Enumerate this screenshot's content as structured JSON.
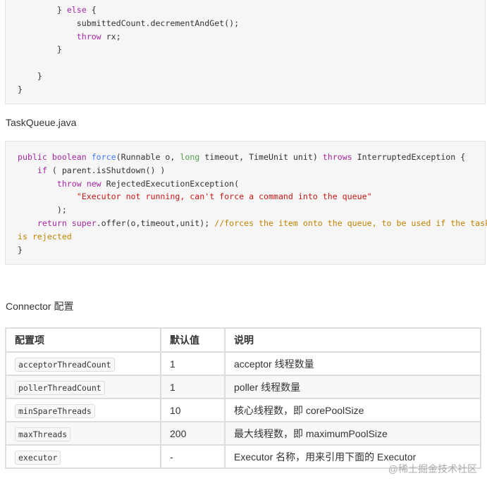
{
  "code1": {
    "lines": [
      [
        {
          "t": "        } "
        },
        {
          "t": "else",
          "c": "kw"
        },
        {
          "t": " {"
        }
      ],
      [
        {
          "t": "            submittedCount.decrementAndGet();"
        }
      ],
      [
        {
          "t": "            "
        },
        {
          "t": "throw",
          "c": "kw"
        },
        {
          "t": " rx;"
        }
      ],
      [
        {
          "t": "        }"
        }
      ],
      [
        {
          "t": ""
        }
      ],
      [
        {
          "t": "    }"
        }
      ],
      [
        {
          "t": "}"
        }
      ]
    ]
  },
  "label1": "TaskQueue.java",
  "code2": {
    "lines": [
      [
        {
          "t": "public boolean ",
          "c": "kw"
        },
        {
          "t": "force",
          "c": "fn"
        },
        {
          "t": "(Runnable o, "
        },
        {
          "t": "long",
          "c": "ty"
        },
        {
          "t": " timeout, TimeUnit unit) "
        },
        {
          "t": "throws",
          "c": "kw"
        },
        {
          "t": " InterruptedException {"
        }
      ],
      [
        {
          "t": "    "
        },
        {
          "t": "if",
          "c": "kw"
        },
        {
          "t": " ( parent.isShutdown() )"
        }
      ],
      [
        {
          "t": "        "
        },
        {
          "t": "throw new",
          "c": "kw"
        },
        {
          "t": " RejectedExecutionException("
        }
      ],
      [
        {
          "t": "            "
        },
        {
          "t": "\"Executor not running, can't force a command into the queue\"",
          "c": "str"
        }
      ],
      [
        {
          "t": "        );"
        }
      ],
      [
        {
          "t": "    "
        },
        {
          "t": "return super",
          "c": "kw"
        },
        {
          "t": ".offer(o,timeout,unit); "
        },
        {
          "t": "//forces the item onto the queue, to be used if the task",
          "c": "cm"
        }
      ],
      [
        {
          "t": "is rejected",
          "c": "cm"
        }
      ],
      [
        {
          "t": "}"
        }
      ]
    ]
  },
  "label2": "Connector 配置",
  "table": {
    "headers": [
      "配置项",
      "默认值",
      "说明"
    ],
    "rows": [
      [
        "acceptorThreadCount",
        "1",
        "acceptor 线程数量"
      ],
      [
        "pollerThreadCount",
        "1",
        "poller 线程数量"
      ],
      [
        "minSpareThreads",
        "10",
        "核心线程数，即 corePoolSize"
      ],
      [
        "maxThreads",
        "200",
        "最大线程数，即 maximumPoolSize"
      ],
      [
        "executor",
        "-",
        "Executor 名称，用来引用下面的 Executor"
      ]
    ]
  },
  "watermark": "@稀土掘金技术社区"
}
